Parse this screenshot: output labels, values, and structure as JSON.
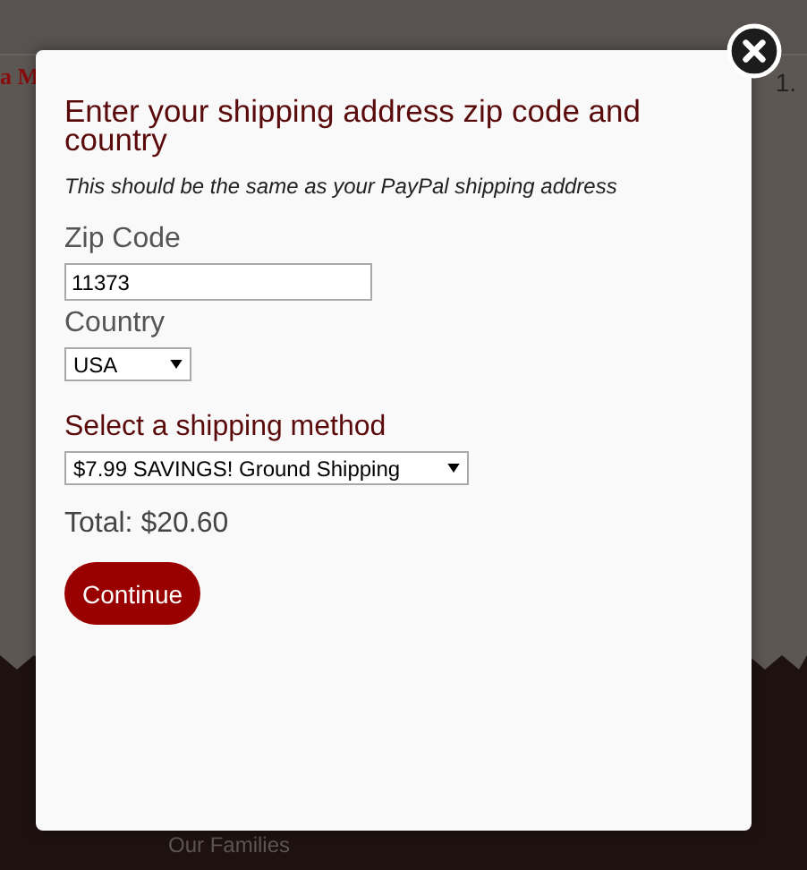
{
  "background": {
    "heading_fragment": "a M",
    "price_fragment": "1.",
    "footer_link": "Our Families"
  },
  "modal": {
    "title": "Enter your shipping address zip code and country",
    "subtitle": "This should be the same as your PayPal shipping address",
    "zip": {
      "label": "Zip Code",
      "value": "11373"
    },
    "country": {
      "label": "Country",
      "value": "USA"
    },
    "shipping": {
      "label": "Select a shipping method",
      "value": "$7.99 SAVINGS! Ground Shipping"
    },
    "total": "Total: $20.60",
    "button": "Continue"
  }
}
